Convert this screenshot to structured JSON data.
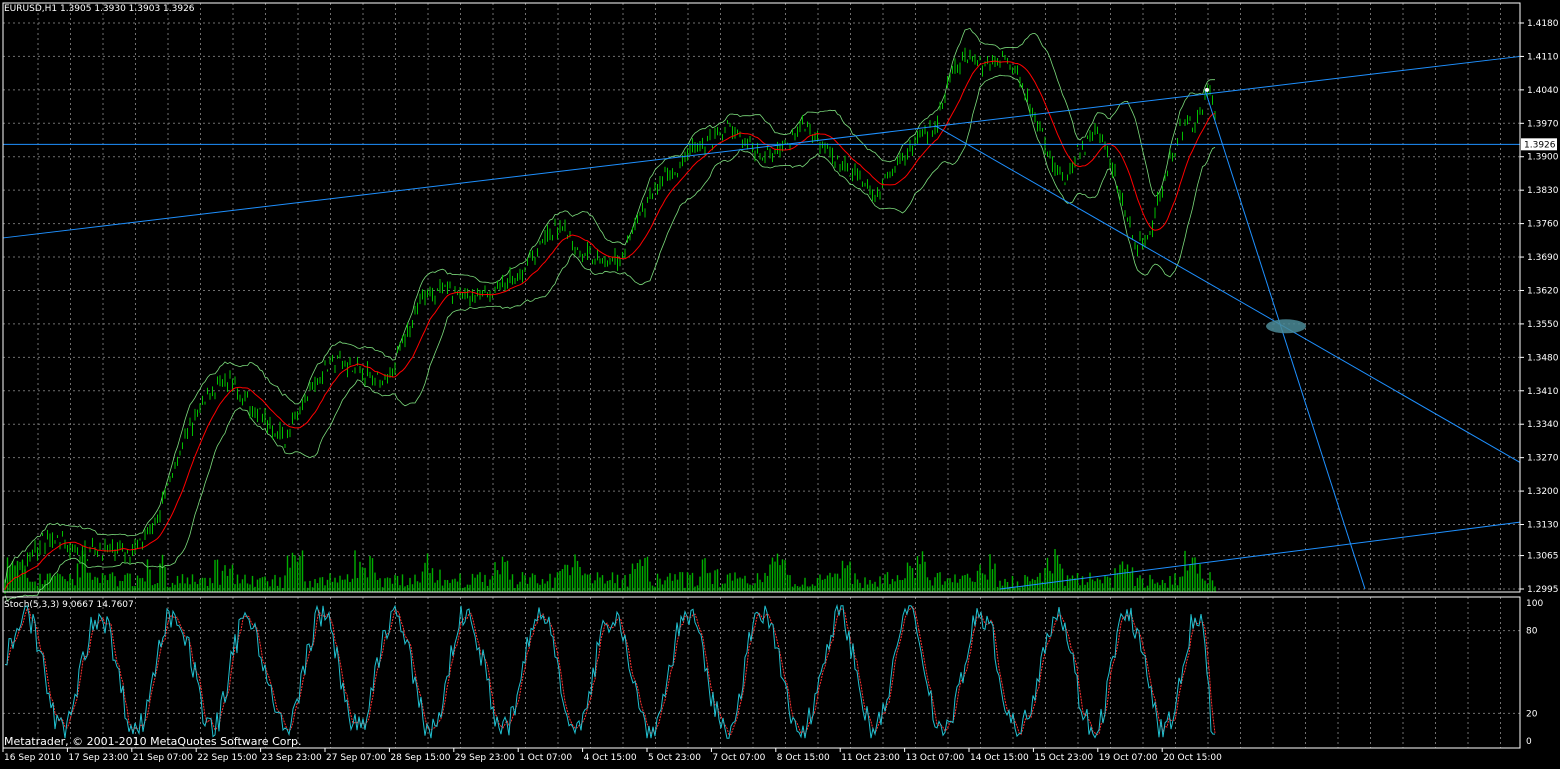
{
  "symbol_info": "EURUSD,H1  1.3905 1.3930 1.3903 1.3926",
  "current_price_label": "1.3926",
  "indicator_info": "Stoch(5,3,3) 9.0667 14.7607",
  "copyright": "Metatrader, © 2001-2010 MetaQuotes Software Corp.",
  "colors": {
    "background": "#000000",
    "grid": "#707070",
    "axis": "#ffffff",
    "candles": "#00c000",
    "volume": "#00b000",
    "moving_average": "#ff0000",
    "bollinger": "#7cdc7c",
    "trendlines": "#1e90ff",
    "stoch_main": "#20c0d0",
    "stoch_signal": "#ff3030",
    "ellipse_marker": "#4a8a96"
  },
  "chart_data": [
    {
      "type": "line",
      "name_on_chart": "EURUSD,H1",
      "ohlc_last": {
        "open": 1.3905,
        "high": 1.393,
        "low": 1.3903,
        "close": 1.3926
      },
      "price_axis_ticks": [
        "1.4180",
        "1.4110",
        "1.4040",
        "1.3970",
        "1.3900",
        "1.3830",
        "1.3760",
        "1.3690",
        "1.3620",
        "1.3550",
        "1.3480",
        "1.3410",
        "1.3340",
        "1.3270",
        "1.3200",
        "1.3130",
        "1.3065",
        "1.2995"
      ],
      "ylim": [
        1.2995,
        1.418
      ],
      "time_axis_labels": [
        "16 Sep 2010",
        "17 Sep 23:00",
        "21 Sep 07:00",
        "22 Sep 15:00",
        "23 Sep 23:00",
        "27 Sep 07:00",
        "28 Sep 15:00",
        "29 Sep 23:00",
        "1 Oct 07:00",
        "4 Oct 15:00",
        "5 Oct 23:00",
        "7 Oct 07:00",
        "8 Oct 15:00",
        "11 Oct 23:00",
        "13 Oct 07:00",
        "14 Oct 15:00",
        "15 Oct 23:00",
        "19 Oct 07:00",
        "20 Oct 15:00"
      ],
      "close_series": [
        [
          0,
          1.301
        ],
        [
          25,
          1.306
        ],
        [
          45,
          1.311
        ],
        [
          70,
          1.307
        ],
        [
          95,
          1.308
        ],
        [
          120,
          1.307
        ],
        [
          135,
          1.309
        ],
        [
          150,
          1.313
        ],
        [
          165,
          1.323
        ],
        [
          185,
          1.333
        ],
        [
          205,
          1.341
        ],
        [
          225,
          1.343
        ],
        [
          245,
          1.338
        ],
        [
          265,
          1.334
        ],
        [
          280,
          1.331
        ],
        [
          300,
          1.34
        ],
        [
          320,
          1.346
        ],
        [
          340,
          1.347
        ],
        [
          360,
          1.345
        ],
        [
          380,
          1.342
        ],
        [
          400,
          1.352
        ],
        [
          415,
          1.36
        ],
        [
          440,
          1.362
        ],
        [
          460,
          1.361
        ],
        [
          480,
          1.361
        ],
        [
          500,
          1.363
        ],
        [
          520,
          1.367
        ],
        [
          540,
          1.373
        ],
        [
          560,
          1.375
        ],
        [
          575,
          1.37
        ],
        [
          595,
          1.369
        ],
        [
          615,
          1.368
        ],
        [
          630,
          1.376
        ],
        [
          650,
          1.383
        ],
        [
          670,
          1.387
        ],
        [
          690,
          1.392
        ],
        [
          710,
          1.394
        ],
        [
          725,
          1.396
        ],
        [
          745,
          1.392
        ],
        [
          760,
          1.39
        ],
        [
          780,
          1.393
        ],
        [
          800,
          1.397
        ],
        [
          815,
          1.393
        ],
        [
          835,
          1.388
        ],
        [
          855,
          1.386
        ],
        [
          870,
          1.382
        ],
        [
          890,
          1.388
        ],
        [
          910,
          1.393
        ],
        [
          930,
          1.396
        ],
        [
          945,
          1.406
        ],
        [
          960,
          1.411
        ],
        [
          980,
          1.409
        ],
        [
          1000,
          1.411
        ],
        [
          1015,
          1.406
        ],
        [
          1030,
          1.398
        ],
        [
          1050,
          1.387
        ],
        [
          1060,
          1.385
        ],
        [
          1075,
          1.391
        ],
        [
          1090,
          1.396
        ],
        [
          1100,
          1.393
        ],
        [
          1115,
          1.383
        ],
        [
          1130,
          1.371
        ],
        [
          1145,
          1.374
        ],
        [
          1160,
          1.385
        ],
        [
          1175,
          1.396
        ],
        [
          1190,
          1.397
        ],
        [
          1205,
          1.404
        ],
        [
          1215,
          1.3926
        ]
      ]
    },
    {
      "type": "line",
      "name_on_chart": "Stoch(5,3,3)",
      "values_shown": {
        "main": 9.0667,
        "signal": 14.7607
      },
      "axis_ticks": [
        "100",
        "80",
        "20",
        "0"
      ],
      "ylim": [
        0,
        100
      ]
    }
  ]
}
